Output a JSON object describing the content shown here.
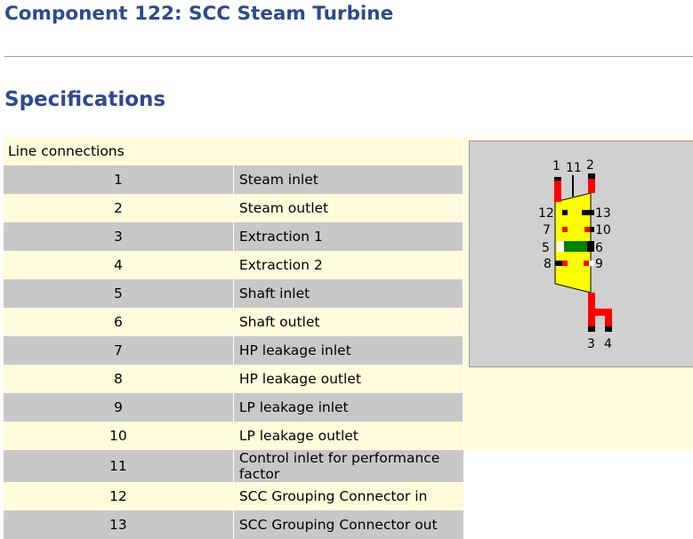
{
  "page": {
    "title": "Component 122: SCC Steam Turbine",
    "section": "Specifications"
  },
  "table": {
    "header": "Line connections",
    "rows": [
      {
        "num": "1",
        "label": "Steam inlet"
      },
      {
        "num": "2",
        "label": "Steam outlet"
      },
      {
        "num": "3",
        "label": "Extraction 1"
      },
      {
        "num": "4",
        "label": "Extraction 2"
      },
      {
        "num": "5",
        "label": "Shaft inlet"
      },
      {
        "num": "6",
        "label": "Shaft outlet"
      },
      {
        "num": "7",
        "label": "HP leakage inlet"
      },
      {
        "num": "8",
        "label": "HP leakage outlet"
      },
      {
        "num": "9",
        "label": "LP leakage inlet"
      },
      {
        "num": "10",
        "label": "LP leakage outlet"
      },
      {
        "num": "11",
        "label": "Control inlet for performance factor"
      },
      {
        "num": "12",
        "label": "SCC Grouping Connector in"
      },
      {
        "num": "13",
        "label": "SCC Grouping Connector out"
      }
    ]
  },
  "diagram": {
    "labels": {
      "p1": "1",
      "p2": "2",
      "p3": "3",
      "p4": "4",
      "p5": "5",
      "p6": "6",
      "p7": "7",
      "p8": "8",
      "p9": "9",
      "p10": "10",
      "p11": "11",
      "p12": "12",
      "p13": "13"
    },
    "colors": {
      "background": "#d0d0d0",
      "turbine": "#ffff00",
      "steam_line": "#ff0000",
      "shaft": "#008000",
      "connector": "#000000"
    }
  }
}
